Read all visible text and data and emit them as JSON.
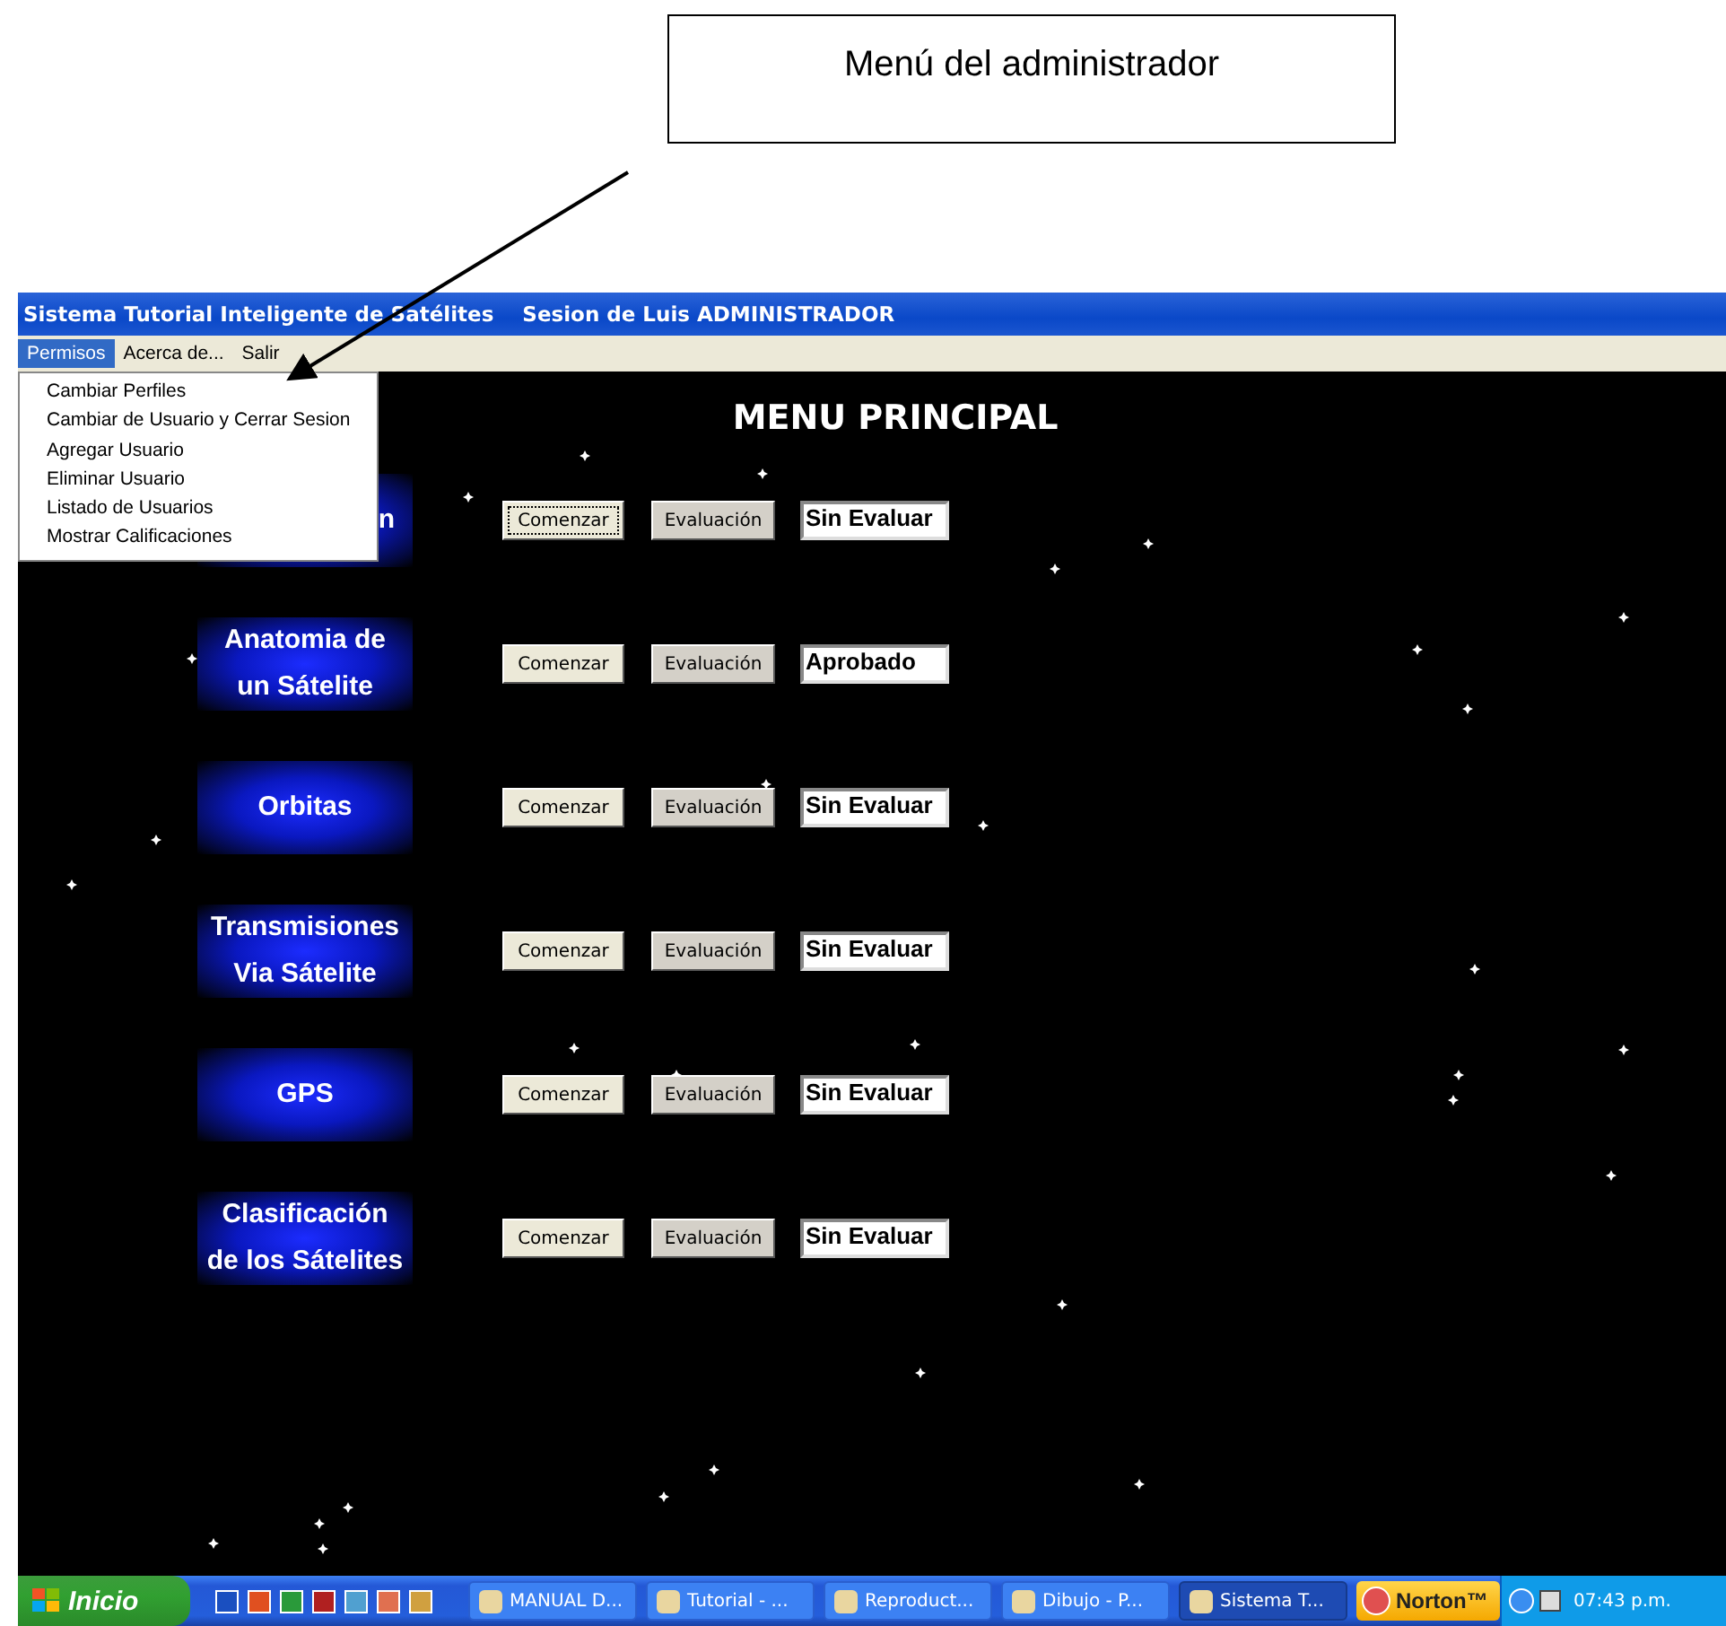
{
  "callout": {
    "text": "Menú del administrador"
  },
  "window": {
    "title": "Sistema Tutorial Inteligente de Satélites    Sesion de Luis ADMINISTRADOR"
  },
  "menu_bar": [
    {
      "label": "Permisos",
      "selected": true
    },
    {
      "label": "Acerca de...",
      "selected": false
    },
    {
      "label": "Salir",
      "selected": false
    }
  ],
  "dropdown": [
    "Cambiar Perfiles",
    "Cambiar de Usuario y Cerrar Sesion",
    "Agregar Usuario",
    "Eliminar Usuario",
    "Listado de Usuarios",
    "Mostrar Calificaciones"
  ],
  "heading": "MENU PRINCIPAL",
  "topics": [
    {
      "title": "n",
      "hidden_by_menu": true,
      "start": "Comenzar",
      "start_focused": true,
      "evaluate": "Evaluación",
      "status": "Sin Evaluar"
    },
    {
      "title": "Anatomia de\nun Sátelite",
      "hidden_by_menu": false,
      "start": "Comenzar",
      "start_focused": false,
      "evaluate": "Evaluación",
      "status": "Aprobado"
    },
    {
      "title": "Orbitas",
      "hidden_by_menu": false,
      "start": "Comenzar",
      "start_focused": false,
      "evaluate": "Evaluación",
      "status": "Sin Evaluar"
    },
    {
      "title": "Transmisiones\nVia Sátelite",
      "hidden_by_menu": false,
      "start": "Comenzar",
      "start_focused": false,
      "evaluate": "Evaluación",
      "status": "Sin Evaluar"
    },
    {
      "title": "GPS",
      "hidden_by_menu": false,
      "start": "Comenzar",
      "start_focused": false,
      "evaluate": "Evaluación",
      "status": "Sin Evaluar"
    },
    {
      "title": "Clasificación\nde los Sátelites",
      "hidden_by_menu": false,
      "start": "Comenzar",
      "start_focused": false,
      "evaluate": "Evaluación",
      "status": "Sin Evaluar"
    }
  ],
  "taskbar": {
    "start": "Inicio",
    "tasks": [
      {
        "label": "MANUAL D...",
        "selected": false
      },
      {
        "label": "Tutorial - ...",
        "selected": false
      },
      {
        "label": "Reproduct...",
        "selected": false
      },
      {
        "label": "Dibujo - P...",
        "selected": false
      },
      {
        "label": "Sistema T...",
        "selected": true
      }
    ],
    "norton": "Norton™",
    "clock": "07:43 p.m."
  }
}
